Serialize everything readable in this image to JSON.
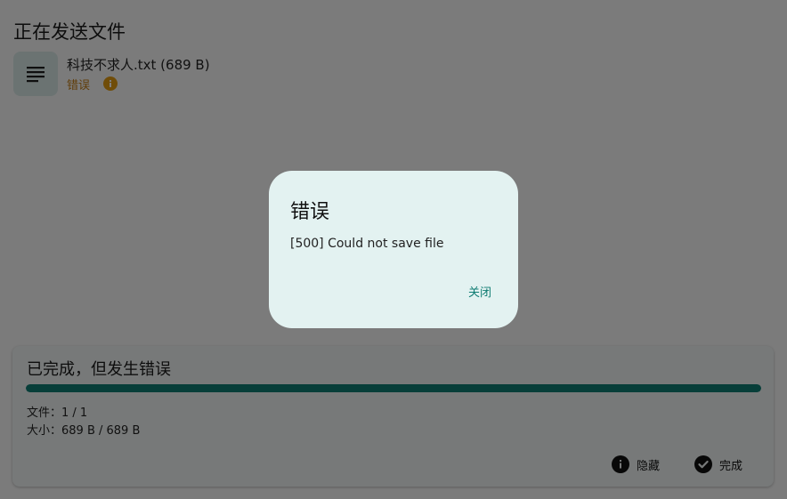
{
  "page": {
    "title": "正在发送文件"
  },
  "file": {
    "name": "科技不求人.txt (689 B)",
    "status": "错误",
    "icon": "document-lines-icon",
    "status_color": "#c07a12"
  },
  "progress_card": {
    "title": "已完成，但发生错误",
    "progress_percent": 100,
    "files_line": "文件：1 / 1",
    "size_line": "大小：689 B / 689 B",
    "hide_label": "隐藏",
    "done_label": "完成",
    "accent": "#0f7c72"
  },
  "dialog": {
    "title": "错误",
    "message": "[500] Could not save file",
    "close_label": "关闭"
  }
}
